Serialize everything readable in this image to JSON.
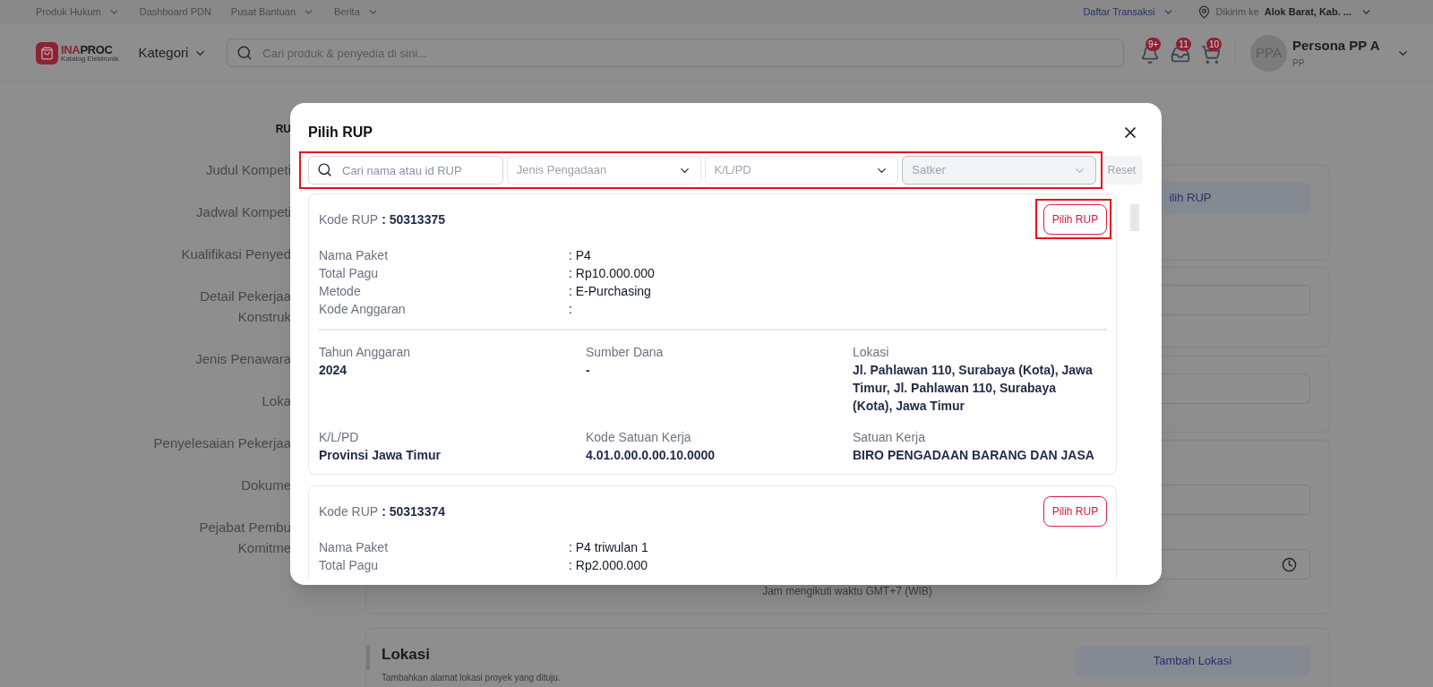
{
  "top_bar": {
    "links": [
      {
        "label": "Produk Hukum",
        "has_menu": true
      },
      {
        "label": "Dashboard PDN",
        "has_menu": false
      },
      {
        "label": "Pusat Bantuan",
        "has_menu": true
      },
      {
        "label": "Berita",
        "has_menu": true
      }
    ],
    "transactions": {
      "label": "Daftar Transaksi"
    },
    "delivery": {
      "label": "Dikirim ke",
      "address": "Alok Barat, Kab. ..."
    }
  },
  "header": {
    "logo": {
      "part_1": "INA",
      "part_2": "PROC",
      "tagline": "Katalog Elektronik"
    },
    "category": "Kategori",
    "search": {
      "placeholder": "Cari produk & penyedia di sini..."
    },
    "notifications": [
      {
        "kind": "bell",
        "badge": "9+"
      },
      {
        "kind": "inbox",
        "badge": "11"
      },
      {
        "kind": "cart",
        "badge": "10"
      }
    ],
    "user": {
      "initials": "PPA",
      "name": "Persona PP A",
      "role": "PP"
    }
  },
  "form_nav": {
    "heading": "RU",
    "items": [
      {
        "lines": [
          "Judul Kompeti"
        ]
      },
      {
        "lines": [
          "Jadwal Kompeti"
        ]
      },
      {
        "lines": [
          "Kualifikasi Penyed"
        ]
      },
      {
        "lines": [
          "Detail Pekerjaa",
          "Konstruk"
        ]
      },
      {
        "lines": [
          "Jenis Penawara"
        ]
      },
      {
        "lines": [
          "Loka"
        ]
      },
      {
        "lines": [
          "Penyelesaian Pekerjaa"
        ]
      },
      {
        "lines": [
          "Dokume"
        ]
      },
      {
        "lines": [
          "Pejabat Pembu",
          "Komitme"
        ]
      }
    ]
  },
  "form": {
    "rup_button": "ilih RUP",
    "time_note": "Jam mengikuti waktu GMT+7 (WIB)",
    "location": {
      "title": "Lokasi",
      "description": "Tambahkan alamat lokasi proyek yang dituju.",
      "button": "Tambah Lokasi"
    }
  },
  "modal": {
    "title": "Pilih RUP",
    "filters": {
      "highlighted": true,
      "search": {
        "placeholder": "Cari nama atau id RUP"
      },
      "selects": [
        {
          "placeholder": "Jenis Pengadaan",
          "disabled": false
        },
        {
          "placeholder": "K/L/PD",
          "disabled": false
        },
        {
          "placeholder": "Satker",
          "disabled": true
        }
      ],
      "reset": "Reset"
    },
    "rup_list": [
      {
        "code_label": "Kode RUP",
        "code": ": 50313375",
        "button": "Pilih RUP",
        "highlighted": true,
        "fields": [
          {
            "label": "Nama Paket",
            "value": ": P4"
          },
          {
            "label": "Total Pagu",
            "value": ": Rp10.000.000"
          },
          {
            "label": "Metode",
            "value": ": E-Purchasing"
          },
          {
            "label": "Kode Anggaran",
            "value": ":"
          }
        ],
        "details": [
          {
            "label": "Tahun Anggaran",
            "value": "2024"
          },
          {
            "label": "Sumber Dana",
            "value": "-"
          },
          {
            "label": "Lokasi",
            "value": "Jl. Pahlawan 110, Surabaya (Kota), Jawa Timur, Jl. Pahlawan 110, Surabaya (Kota), Jawa Timur"
          },
          {
            "label": "K/L/PD",
            "value": "Provinsi Jawa Timur"
          },
          {
            "label": "Kode Satuan Kerja",
            "value": "4.01.0.00.0.00.10.0000"
          },
          {
            "label": "Satuan Kerja",
            "value": "BIRO PENGADAAN BARANG DAN JASA"
          }
        ]
      },
      {
        "code_label": "Kode RUP",
        "code": ": 50313374",
        "button": "Pilih RUP",
        "highlighted": false,
        "fields": [
          {
            "label": "Nama Paket",
            "value": ": P4 triwulan 1"
          },
          {
            "label": "Total Pagu",
            "value": ": Rp2.000.000"
          }
        ]
      }
    ]
  }
}
